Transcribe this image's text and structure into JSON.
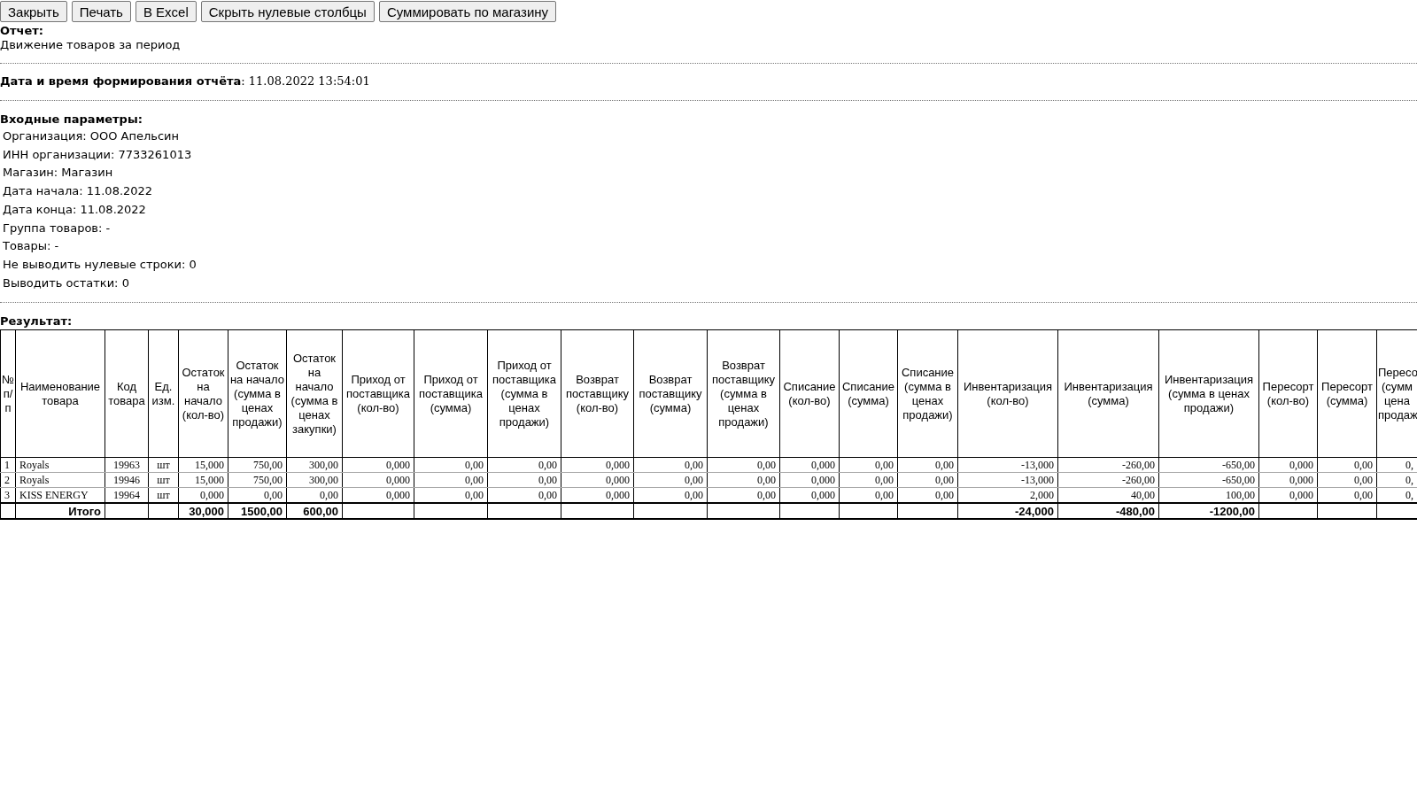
{
  "buttons": [
    "Закрыть",
    "Печать",
    "В Excel",
    "Скрыть нулевые столбцы",
    "Суммировать по магазину"
  ],
  "report": {
    "label": "Отчет:",
    "value": "Движение товаров за период"
  },
  "generated": {
    "label": "Дата и время формирования отчёта",
    "value": ": 11.08.2022 13:54:01"
  },
  "params": {
    "title": "Входные параметры:",
    "items": [
      "Организация: ООО Апельсин",
      "ИНН организации: 7733261013",
      "Магазин: Магазин",
      "Дата начала: 11.08.2022",
      "Дата конца: 11.08.2022",
      "Группа товаров: -",
      "Товары: -",
      "Не выводить нулевые строки: 0",
      "Выводить остатки: 0"
    ]
  },
  "result": {
    "title": "Результат:",
    "table": {
      "columns": [
        "№ п/п",
        "Наименование товара",
        "Код товара",
        "Ед. изм.",
        "Остаток на начало (кол-во)",
        "Остаток на начало (сумма в ценах продажи)",
        "Остаток на начало (сумма в ценах закупки)",
        "Приход от поставщика (кол-во)",
        "Приход от поставщика (сумма)",
        "Приход от поставщика (сумма в ценах продажи)",
        "Возврат поставщику (кол-во)",
        "Возврат поставщику (сумма)",
        "Возврат поставщику (сумма в ценах продажи)",
        "Списание (кол-во)",
        "Списание (сумма)",
        "Списание (сумма в ценах продажи)",
        "Инвентаризация (кол-во)",
        "Инвентаризация (сумма)",
        "Инвентаризация (сумма в ценах продажи)",
        "Пересорт (кол-во)",
        "Пересорт (сумма)",
        "Пересо (сумм цена продаж"
      ],
      "rows": [
        [
          "1",
          "Royals",
          "19963",
          "шт",
          "15,000",
          "750,00",
          "300,00",
          "0,000",
          "0,00",
          "0,00",
          "0,000",
          "0,00",
          "0,00",
          "0,000",
          "0,00",
          "0,00",
          "-13,000",
          "-260,00",
          "-650,00",
          "0,000",
          "0,00",
          "0,"
        ],
        [
          "2",
          "Royals",
          "19946",
          "шт",
          "15,000",
          "750,00",
          "300,00",
          "0,000",
          "0,00",
          "0,00",
          "0,000",
          "0,00",
          "0,00",
          "0,000",
          "0,00",
          "0,00",
          "-13,000",
          "-260,00",
          "-650,00",
          "0,000",
          "0,00",
          "0,"
        ],
        [
          "3",
          "KISS ENERGY",
          "19964",
          "шт",
          "0,000",
          "0,00",
          "0,00",
          "0,000",
          "0,00",
          "0,00",
          "0,000",
          "0,00",
          "0,00",
          "0,000",
          "0,00",
          "0,00",
          "2,000",
          "40,00",
          "100,00",
          "0,000",
          "0,00",
          "0,"
        ]
      ],
      "total": {
        "label": "Итого",
        "stock": [
          "30,000",
          "1500,00",
          "600,00"
        ],
        "inventory": [
          "-24,000",
          "-480,00",
          "-1200,00"
        ]
      }
    }
  }
}
